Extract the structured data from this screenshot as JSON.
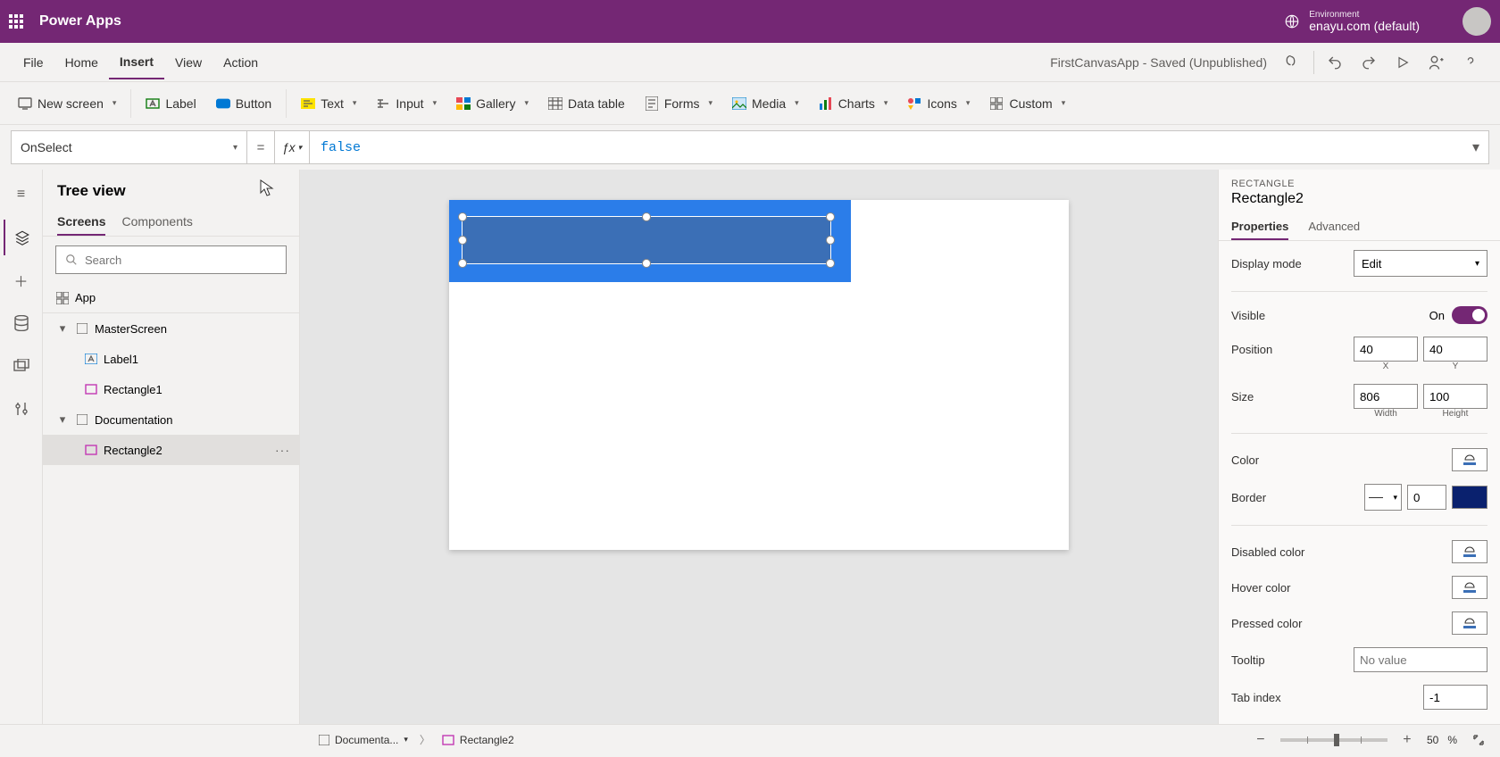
{
  "topbar": {
    "appname": "Power Apps",
    "env_label": "Environment",
    "env_name": "enayu.com (default)"
  },
  "menu": {
    "items": [
      "File",
      "Home",
      "Insert",
      "View",
      "Action"
    ],
    "active": "Insert",
    "docstatus": "FirstCanvasApp - Saved (Unpublished)"
  },
  "ribbon": {
    "newscreen": "New screen",
    "label": "Label",
    "button": "Button",
    "text": "Text",
    "input": "Input",
    "gallery": "Gallery",
    "datatable": "Data table",
    "forms": "Forms",
    "media": "Media",
    "charts": "Charts",
    "icons": "Icons",
    "custom": "Custom"
  },
  "formula": {
    "property": "OnSelect",
    "value": "false"
  },
  "tree": {
    "title": "Tree view",
    "tabs": {
      "screens": "Screens",
      "components": "Components"
    },
    "search_placeholder": "Search",
    "app": "App",
    "nodes": [
      {
        "name": "MasterScreen",
        "children": [
          {
            "name": "Label1",
            "kind": "label"
          },
          {
            "name": "Rectangle1",
            "kind": "rect"
          }
        ]
      },
      {
        "name": "Documentation",
        "children": [
          {
            "name": "Rectangle2",
            "kind": "rect",
            "selected": true
          }
        ]
      }
    ]
  },
  "properties": {
    "category": "RECTANGLE",
    "name": "Rectangle2",
    "tabs": {
      "properties": "Properties",
      "advanced": "Advanced"
    },
    "display_mode_label": "Display mode",
    "display_mode": "Edit",
    "visible_label": "Visible",
    "visible_text": "On",
    "position_label": "Position",
    "x": "40",
    "y": "40",
    "x_lab": "X",
    "y_lab": "Y",
    "size_label": "Size",
    "w": "806",
    "h": "100",
    "w_lab": "Width",
    "h_lab": "Height",
    "color_label": "Color",
    "border_label": "Border",
    "border_width": "0",
    "disabled_label": "Disabled color",
    "hover_label": "Hover color",
    "pressed_label": "Pressed color",
    "tooltip_label": "Tooltip",
    "tooltip_ph": "No value",
    "tabindex_label": "Tab index",
    "tabindex": "-1"
  },
  "status": {
    "screen": "Documenta...",
    "element": "Rectangle2",
    "zoom": "50",
    "zoom_unit": "%"
  }
}
